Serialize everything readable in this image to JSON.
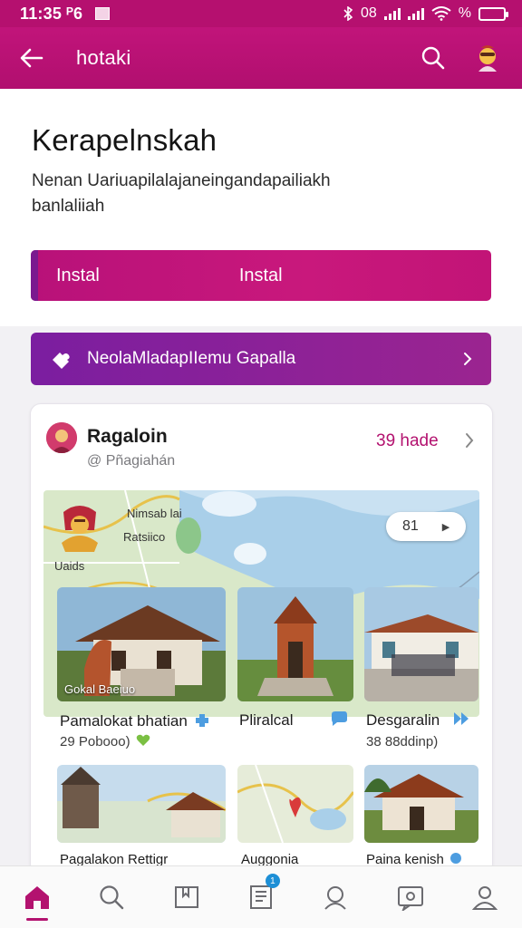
{
  "status_bar": {
    "time": "11:35 ᴾ6",
    "battery_text": "%",
    "network_text": "08",
    "battery_level": 0.85
  },
  "app_bar": {
    "title": "hotaki"
  },
  "hero": {
    "title": "Kerapelnskah",
    "description": "Nenan Uariuapilalajaneingandapailiakh banlaliiah",
    "install_label_1": "Instal",
    "install_label_2": "Instal"
  },
  "promo": {
    "label": "NeolaMladapIIemu Gapalla"
  },
  "card": {
    "name": "Ragaloin",
    "handle": "@ Pñagiahán",
    "count": "39 hade",
    "map": {
      "labels": [
        "Nimsab lai",
        "Ratsiico",
        "Uaids"
      ],
      "pill_value": "81"
    },
    "items": [
      {
        "caption": "Gokal Baeiuo",
        "title": "Pamalokat bhatian",
        "subtitle": "29 Pobooo)"
      },
      {
        "caption": "",
        "title": "Pliralcal",
        "subtitle": ""
      },
      {
        "caption": "",
        "title": "Desgaralin",
        "subtitle": "38 88ddinp)"
      }
    ],
    "bottom_items": [
      "Pagalakon Rettigr",
      "Auggonia",
      "Paina kenish"
    ]
  },
  "nav": [
    "home",
    "search",
    "library",
    "feed",
    "community",
    "messages",
    "profile"
  ],
  "colors": {
    "primary": "#b3126f",
    "promo": "#7b1ea0",
    "badge": "#1d8fd6"
  },
  "nav_badge": "1"
}
